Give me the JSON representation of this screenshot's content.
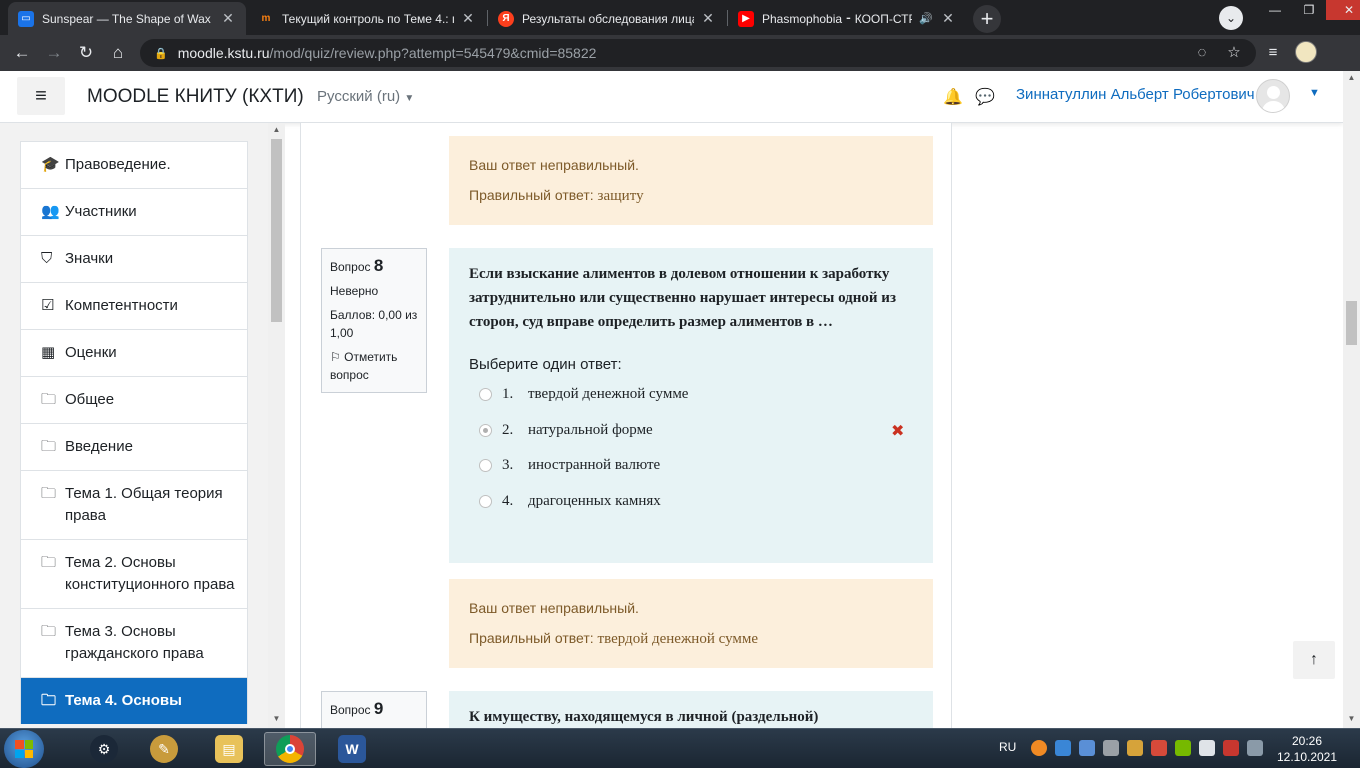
{
  "browser": {
    "tabs": [
      {
        "title": "Sunspear — The Shape of Wax",
        "icon": "chat-icon",
        "color": "#1a73e8",
        "active": true
      },
      {
        "title": "Текущий контроль по Теме 4.: п",
        "icon": "moodle-icon",
        "color": "#f98012",
        "active": false
      },
      {
        "title": "Результаты обследования лица,",
        "icon": "yandex-icon",
        "color": "#fc3f1d",
        "active": false
      },
      {
        "title": "Phasmophobia ⁃ КООП-СТР",
        "icon": "youtube-icon",
        "color": "#ff0000",
        "active": false
      }
    ],
    "url_host": "moodle.kstu.ru",
    "url_path": "/mod/quiz/review.php?attempt=545479&cmid=85822"
  },
  "navbar": {
    "site_name": "MOODLE КНИТУ (КХТИ)",
    "language": "Русский (ru)",
    "user_name": "Зиннатуллин Альберт Робертович"
  },
  "drawer": {
    "items": [
      {
        "label": "Правоведение.",
        "icon": "graduation-cap-icon",
        "glyph": "🎓"
      },
      {
        "label": "Участники",
        "icon": "users-icon",
        "glyph": "👥"
      },
      {
        "label": "Значки",
        "icon": "shield-icon",
        "glyph": "⛉"
      },
      {
        "label": "Компетентности",
        "icon": "checkbox-icon",
        "glyph": "☑"
      },
      {
        "label": "Оценки",
        "icon": "table-icon",
        "glyph": "▦"
      },
      {
        "label": "Общее",
        "icon": "folder-icon",
        "glyph": "🗀"
      },
      {
        "label": "Введение",
        "icon": "folder-icon",
        "glyph": "🗀"
      },
      {
        "label": "Тема 1. Общая теория права",
        "icon": "folder-icon",
        "glyph": "🗀"
      },
      {
        "label": "Тема 2. Основы конституционного права",
        "icon": "folder-icon",
        "glyph": "🗀"
      },
      {
        "label": "Тема 3. Основы гражданского права",
        "icon": "folder-icon",
        "glyph": "🗀"
      },
      {
        "label": "Тема 4. Основы",
        "icon": "folder-icon",
        "glyph": "🗀",
        "active": true
      }
    ]
  },
  "feedback_top": {
    "verdict": "Ваш ответ неправильный.",
    "correct_prefix": "Правильный ответ: ",
    "correct_answer": "защиту"
  },
  "question8": {
    "label": "Вопрос",
    "number": "8",
    "state": "Неверно",
    "grade": "Баллов: 0,00 из 1,00",
    "flag": "Отметить вопрос",
    "text": "Если взыскание алиментов в долевом отношении к заработку затруднительно или существенно нарушает интересы одной из сторон, суд вправе определить размер алиментов в …",
    "prompt": "Выберите один ответ:",
    "options": [
      {
        "num": "1.",
        "text": "твердой денежной сумме",
        "checked": false,
        "wrong": false
      },
      {
        "num": "2.",
        "text": "натуральной форме",
        "checked": true,
        "wrong": true
      },
      {
        "num": "3.",
        "text": "иностранной валюте",
        "checked": false,
        "wrong": false
      },
      {
        "num": "4.",
        "text": "драгоценных камнях",
        "checked": false,
        "wrong": false
      }
    ],
    "feedback": {
      "verdict": "Ваш ответ неправильный.",
      "correct_prefix": "Правильный ответ: ",
      "correct_answer": "твердой денежной сумме"
    }
  },
  "question9": {
    "label": "Вопрос",
    "number": "9",
    "text": "К имуществу, находящемуся в личной (раздельной)"
  },
  "taskbar": {
    "lang": "RU",
    "time": "20:26",
    "date": "12.10.2021"
  }
}
